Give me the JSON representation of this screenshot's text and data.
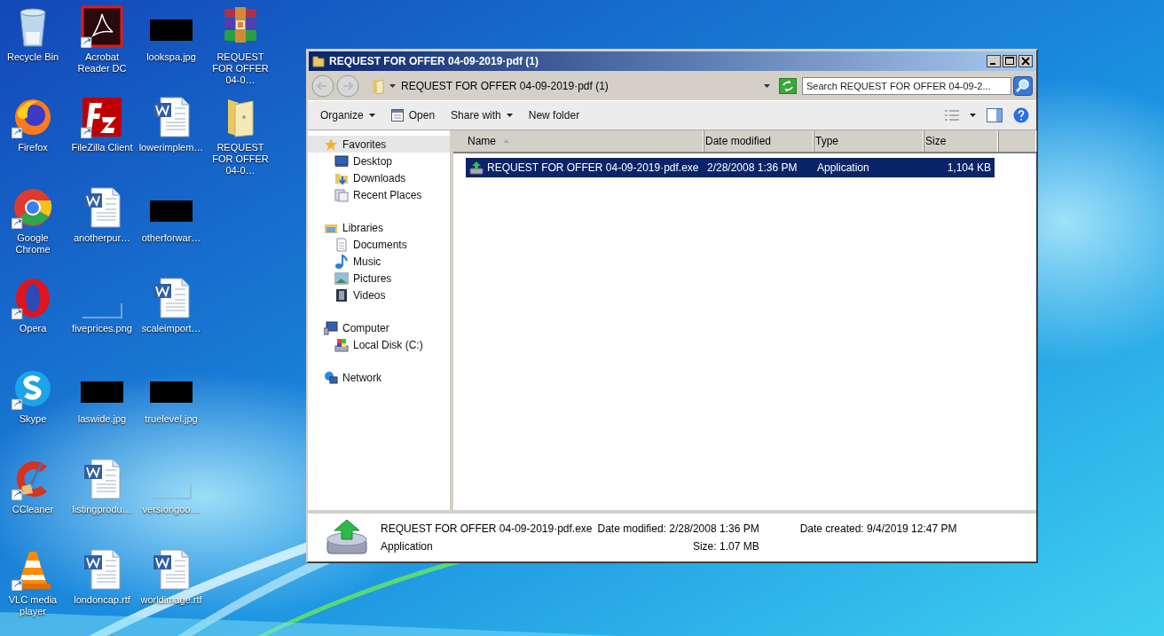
{
  "desktop": {
    "columns": [
      {
        "icons": [
          {
            "label": "Recycle Bin",
            "kind": "recycle",
            "shortcut": false
          },
          {
            "label": "Firefox",
            "kind": "firefox",
            "shortcut": true
          },
          {
            "label": "Google Chrome",
            "kind": "chrome",
            "shortcut": true
          },
          {
            "label": "Opera",
            "kind": "opera",
            "shortcut": true
          },
          {
            "label": "Skype",
            "kind": "skype",
            "shortcut": true
          },
          {
            "label": "CCleaner",
            "kind": "ccleaner",
            "shortcut": true
          },
          {
            "label": "VLC media player",
            "kind": "vlc",
            "shortcut": true
          }
        ]
      },
      {
        "icons": [
          {
            "label": "Acrobat Reader DC",
            "kind": "acrobat",
            "shortcut": true
          },
          {
            "label": "FileZilla Client",
            "kind": "filezilla",
            "shortcut": true
          },
          {
            "label": "anotherpur…",
            "kind": "word",
            "shortcut": false
          },
          {
            "label": "fiveprices.png",
            "kind": "blank",
            "shortcut": false
          },
          {
            "label": "laswide.jpg",
            "kind": "dark",
            "shortcut": false
          },
          {
            "label": "listingprodu…",
            "kind": "word",
            "shortcut": false
          },
          {
            "label": "londoncap.rtf",
            "kind": "word",
            "shortcut": false
          }
        ]
      },
      {
        "icons": [
          {
            "label": "lookspa.jpg",
            "kind": "dark",
            "shortcut": false
          },
          {
            "label": "lowerimplem…",
            "kind": "word",
            "shortcut": false
          },
          {
            "label": "otherforwar…",
            "kind": "dark",
            "shortcut": false
          },
          {
            "label": "scaleimport…",
            "kind": "word",
            "shortcut": false
          },
          {
            "label": "truelevel.jpg",
            "kind": "dark",
            "shortcut": false
          },
          {
            "label": "versiongoo…",
            "kind": "blank",
            "shortcut": false
          },
          {
            "label": "worldimage.rtf",
            "kind": "word",
            "shortcut": false
          }
        ]
      },
      {
        "icons": [
          {
            "label": "REQUEST FOR OFFER 04-0…",
            "kind": "archive",
            "shortcut": false
          },
          {
            "label": "REQUEST FOR OFFER 04-0…",
            "kind": "folder",
            "shortcut": false
          }
        ]
      }
    ]
  },
  "window": {
    "title": "REQUEST FOR OFFER 04-09-2019·pdf (1)",
    "address": {
      "path": "REQUEST FOR OFFER 04-09-2019·pdf (1)"
    },
    "search": {
      "placeholder": "Search REQUEST FOR OFFER 04-09-2..."
    },
    "toolbar": [
      {
        "label": "Organize",
        "kind": "menu"
      },
      {
        "label": "Open",
        "kind": "open"
      },
      {
        "label": "Share with",
        "kind": "menu"
      },
      {
        "label": "New folder",
        "kind": "plain"
      }
    ],
    "nav": [
      {
        "label": "Favorites",
        "kind": "star",
        "selected": true,
        "children": [
          {
            "label": "Desktop",
            "kind": "desktop",
            "selected": false
          },
          {
            "label": "Downloads",
            "kind": "downloads",
            "selected": false
          },
          {
            "label": "Recent Places",
            "kind": "recent",
            "selected": false
          }
        ]
      },
      {
        "label": "Libraries",
        "kind": "library",
        "selected": false,
        "children": [
          {
            "label": "Documents",
            "kind": "documents",
            "selected": false
          },
          {
            "label": "Music",
            "kind": "music",
            "selected": false
          },
          {
            "label": "Pictures",
            "kind": "pictures",
            "selected": false
          },
          {
            "label": "Videos",
            "kind": "videos",
            "selected": false
          }
        ]
      },
      {
        "label": "Computer",
        "kind": "computer",
        "selected": false,
        "children": [
          {
            "label": "Local Disk (C:)",
            "kind": "disk",
            "selected": false
          }
        ]
      },
      {
        "label": "Network",
        "kind": "network",
        "selected": false
      }
    ],
    "columns": [
      {
        "label": "Name",
        "sorted": true
      },
      {
        "label": "Date modified",
        "sorted": false
      },
      {
        "label": "Type",
        "sorted": false
      },
      {
        "label": "Size",
        "sorted": false
      }
    ],
    "rows": [
      {
        "name": "REQUEST FOR OFFER 04-09-2019·pdf.exe",
        "date": "2/28/2008 1:36 PM",
        "type": "Application",
        "size": "1,104 KB",
        "selected": true
      }
    ],
    "details": {
      "name": "REQUEST FOR OFFER 04-09-2019·pdf.exe",
      "type": "Application",
      "modified": "Date modified: 2/28/2008 1:36 PM",
      "size": "Size: 1.07 MB",
      "created": "Date created: 9/4/2019 12:47 PM"
    }
  }
}
